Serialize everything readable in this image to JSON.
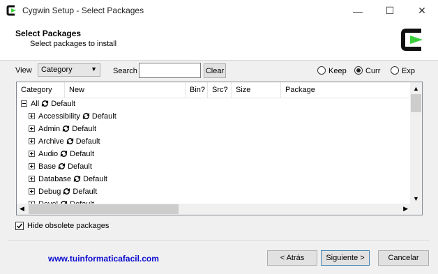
{
  "window": {
    "title": "Cygwin Setup - Select Packages",
    "minimize": "—",
    "maximize": "☐",
    "close": "✕"
  },
  "header": {
    "title": "Select Packages",
    "subtitle": "Select packages to install"
  },
  "toolbar": {
    "view_label": "View",
    "view_value": "Category",
    "search_label": "Search",
    "search_value": "",
    "clear_label": "Clear",
    "radios": [
      {
        "label": "Keep",
        "selected": false
      },
      {
        "label": "Curr",
        "selected": true
      },
      {
        "label": "Exp",
        "selected": false
      }
    ]
  },
  "grid": {
    "columns": [
      "Category",
      "New",
      "Bin?",
      "Src?",
      "Size",
      "Package"
    ],
    "root": {
      "label": "All",
      "value": "Default"
    },
    "rows": [
      {
        "label": "Accessibility",
        "value": "Default"
      },
      {
        "label": "Admin",
        "value": "Default"
      },
      {
        "label": "Archive",
        "value": "Default"
      },
      {
        "label": "Audio",
        "value": "Default"
      },
      {
        "label": "Base",
        "value": "Default"
      },
      {
        "label": "Database",
        "value": "Default"
      },
      {
        "label": "Debug",
        "value": "Default"
      },
      {
        "label": "Devel",
        "value": "Default"
      }
    ]
  },
  "options": {
    "hide_obsolete_label": "Hide obsolete packages",
    "hide_obsolete_checked": true
  },
  "footer": {
    "link": "www.tuinformaticafacil.com",
    "back_label": "< Atrás",
    "next_label": "Siguiente >",
    "cancel_label": "Cancelar"
  },
  "colors": {
    "logo_green": "#3ccf3c",
    "link": "#0a0ad0"
  }
}
